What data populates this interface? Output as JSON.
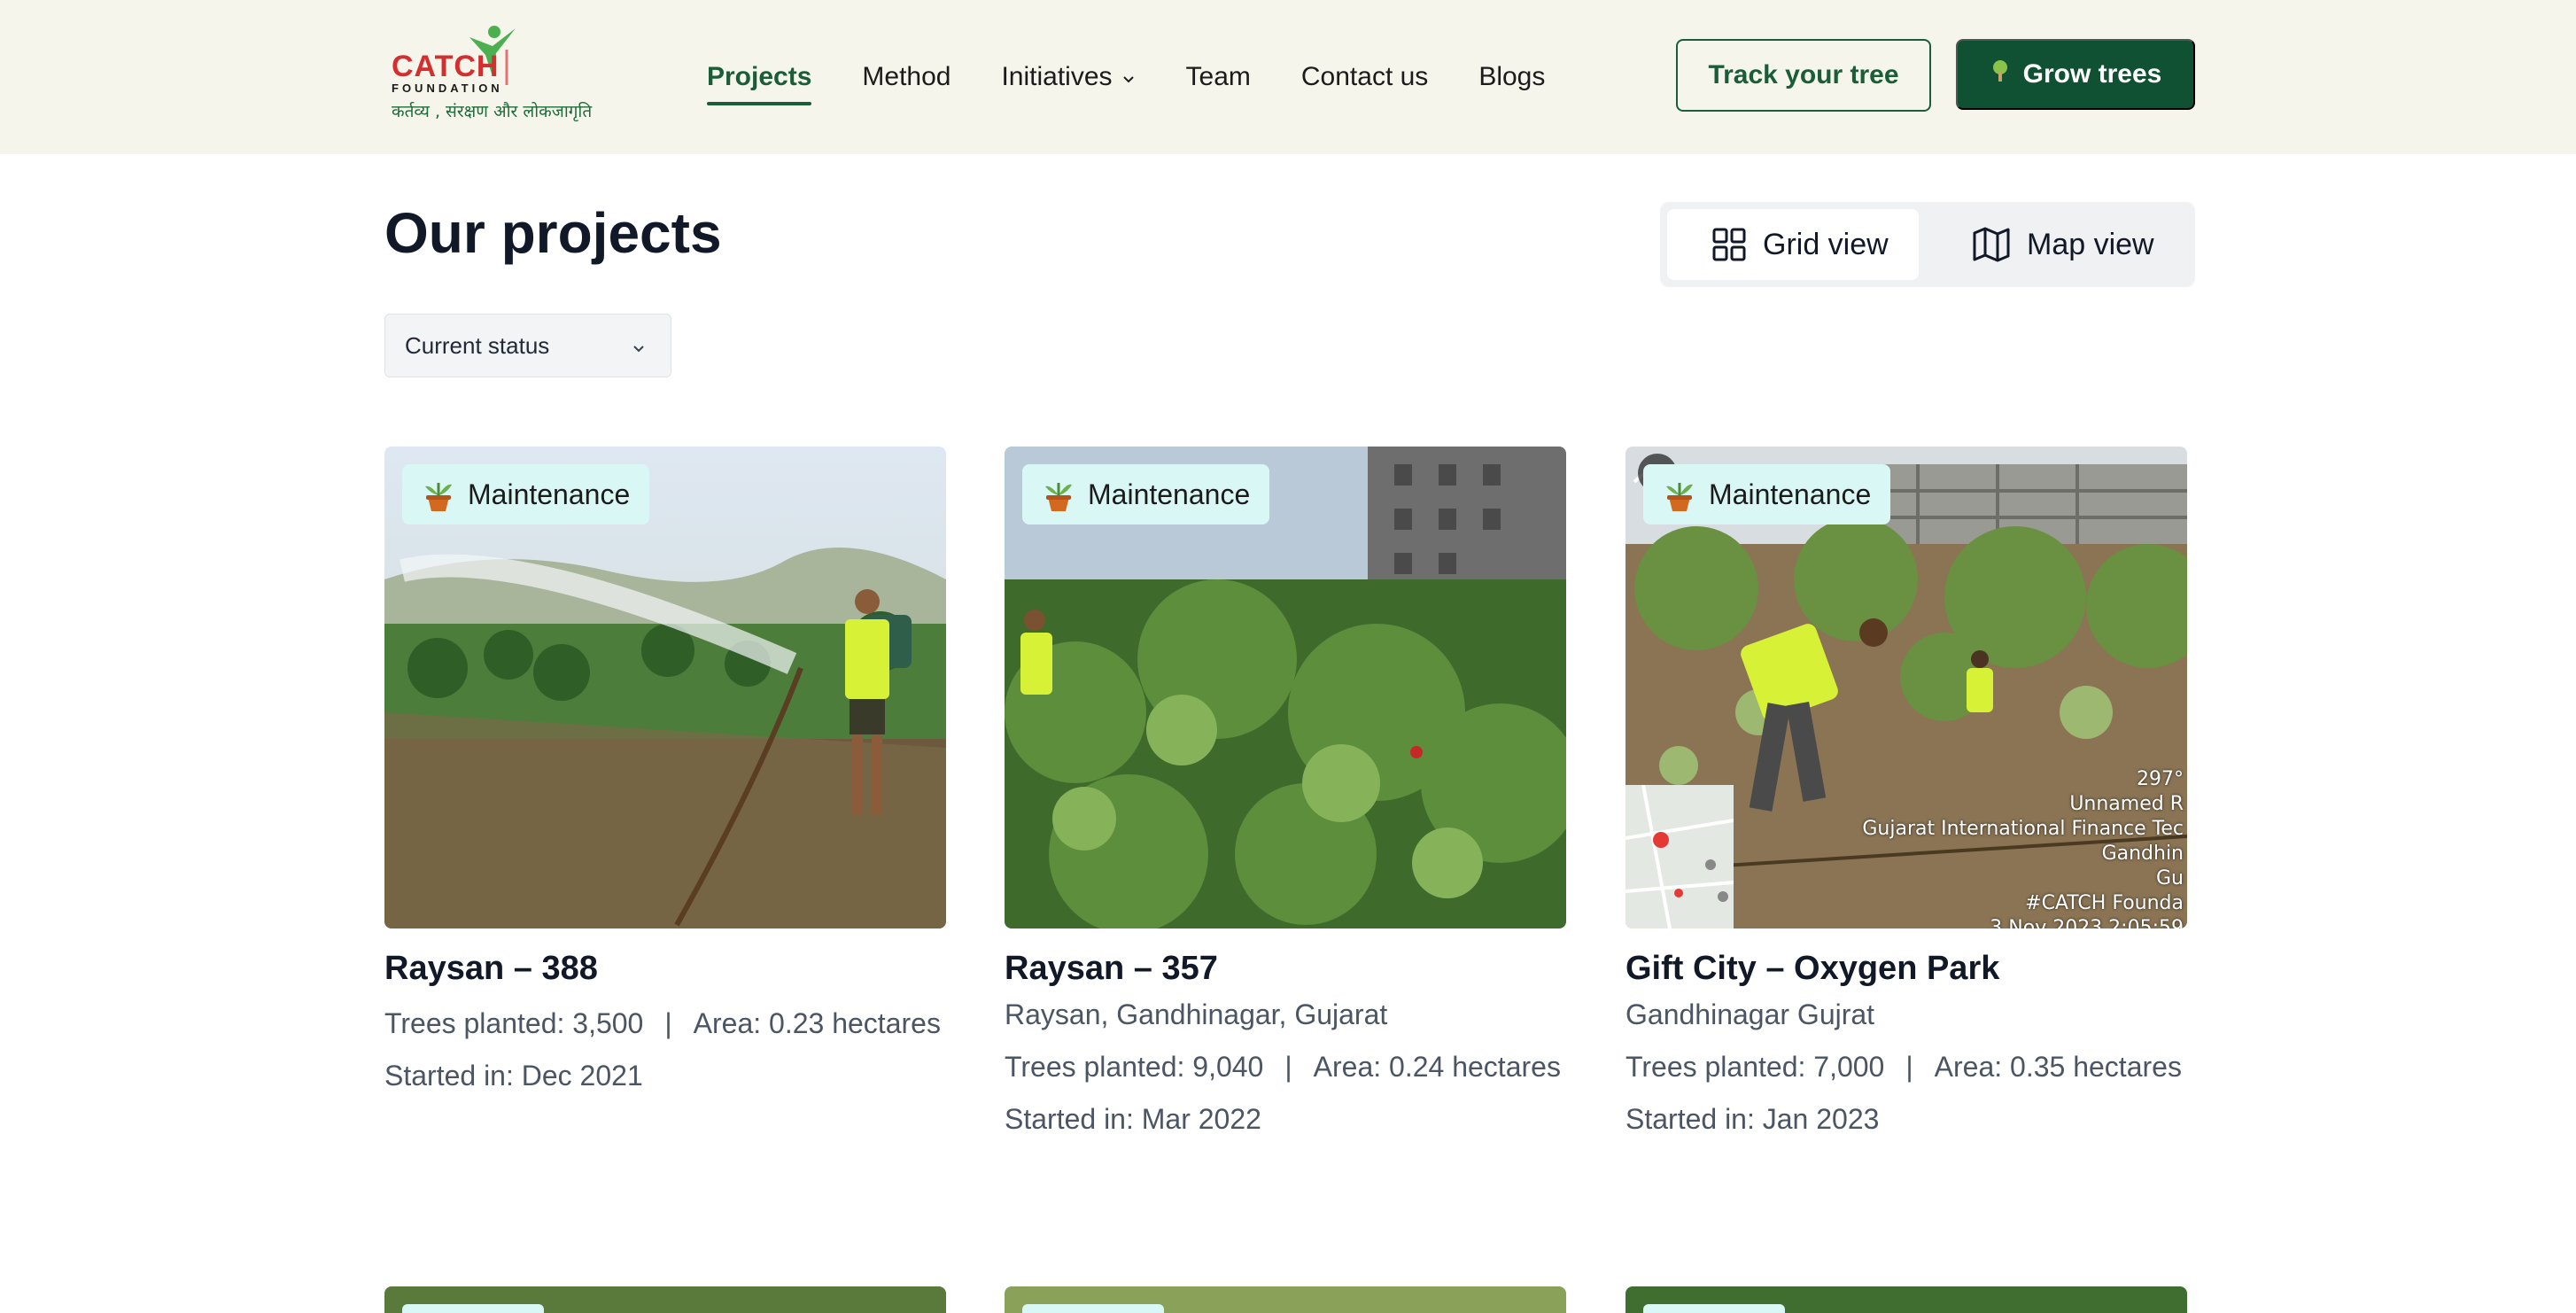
{
  "header": {
    "logo": {
      "brand": "CATCH",
      "brand_sub": "FOUNDATION",
      "tagline": "कर्तव्य , संरक्षण और लोकजागृति"
    },
    "nav": [
      {
        "label": "Projects",
        "active": true
      },
      {
        "label": "Method"
      },
      {
        "label": "Initiatives",
        "has_dropdown": true
      },
      {
        "label": "Team"
      },
      {
        "label": "Contact us"
      },
      {
        "label": "Blogs"
      }
    ],
    "track_label": "Track your tree",
    "grow_label": "Grow trees"
  },
  "page": {
    "title": "Our projects",
    "view_toggle": {
      "grid": "Grid view",
      "map": "Map view",
      "selected": "Grid view"
    },
    "status_filter": "Current status"
  },
  "projects": [
    {
      "status": "Maintenance",
      "name": "Raysan – 388",
      "location": "",
      "trees": "Trees planted: 3,500",
      "area": "Area: 0.23 hectares",
      "started": "Started in: Dec 2021"
    },
    {
      "status": "Maintenance",
      "name": "Raysan – 357",
      "location": "Raysan, Gandhinagar, Gujarat",
      "trees": "Trees planted: 9,040",
      "area": "Area: 0.24 hectares",
      "started": "Started in: Mar 2022"
    },
    {
      "status": "Maintenance",
      "name": "Gift City – Oxygen Park",
      "location": "Gandhinagar Gujrat",
      "trees": "Trees planted: 7,000",
      "area": "Area: 0.35 hectares",
      "started": "Started in: Jan 2023",
      "photo_overlay": [
        "297°",
        "Unnamed R",
        "Gujarat International Finance Tec",
        "Gandhin",
        "Gu",
        "#CATCH Founda",
        "3 Nov 2023 2:05:59"
      ]
    }
  ],
  "colors": {
    "primary": "#0f5132",
    "header_bg": "#f5f5ec",
    "badge_bg": "#d9f7f5"
  },
  "separator": "|"
}
